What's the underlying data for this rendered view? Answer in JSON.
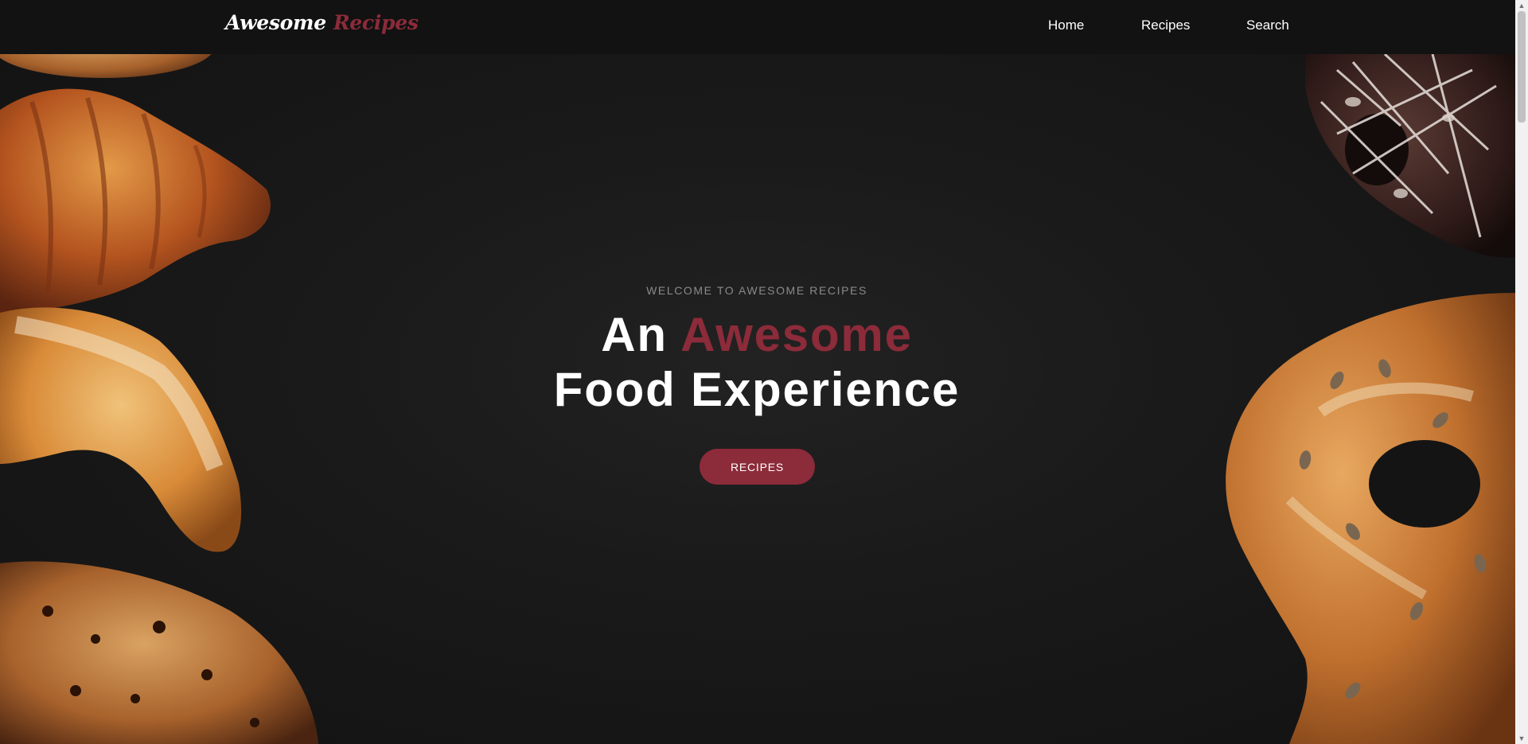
{
  "brand": {
    "name_part1": "Awesome",
    "name_part2": "Recipes",
    "accent_color": "#8c2b3a"
  },
  "nav": {
    "home": "Home",
    "recipes": "Recipes",
    "search": "Search"
  },
  "hero": {
    "kicker": "WELCOME TO AWESOME RECIPES",
    "headline_line1_prefix": "An",
    "headline_line1_accent": "Awesome",
    "headline_line2": "Food Experience",
    "cta_label": "RECIPES",
    "background_images": [
      "croissant",
      "bread-roll",
      "rustic-bread",
      "chocolate-donut",
      "seeded-pretzel"
    ]
  },
  "scrollbar": {
    "up_icon": "up-arrow-icon",
    "down_icon": "down-arrow-icon"
  }
}
